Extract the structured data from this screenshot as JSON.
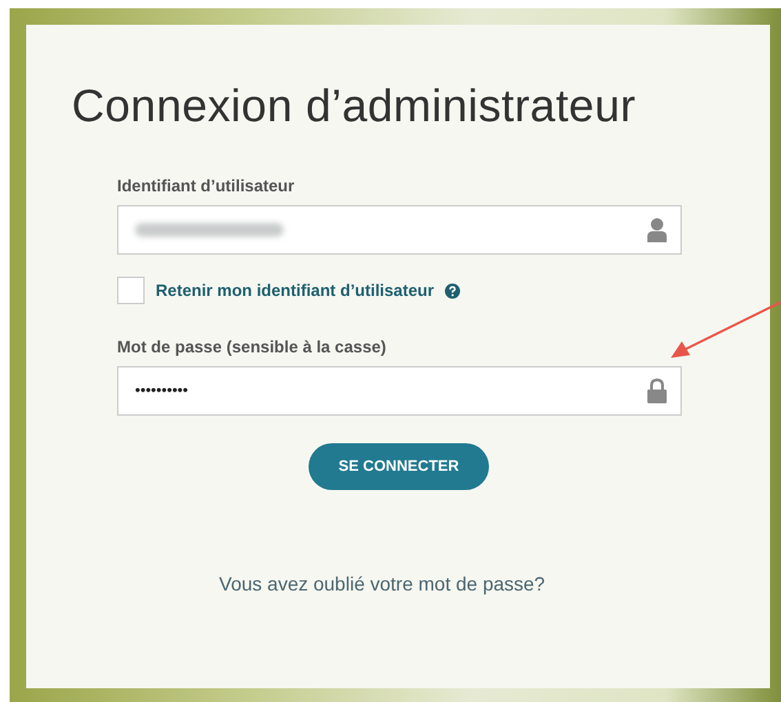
{
  "title": "Connexion d’administrateur",
  "username": {
    "label": "Identifiant d’utilisateur",
    "redacted": true
  },
  "remember": {
    "label": "Retenir mon identifiant d’utilisateur",
    "checked": false
  },
  "password": {
    "label": "Mot de passe (sensible à la casse)",
    "value": "••••••••••"
  },
  "submit": "SE CONNECTER",
  "forgot_link": "Vous avez oublié votre mot de passe?"
}
